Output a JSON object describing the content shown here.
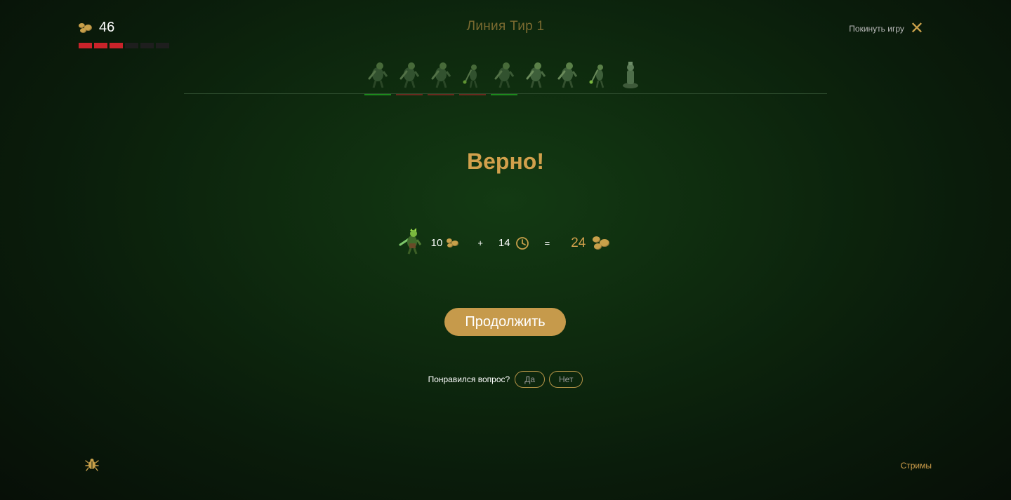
{
  "header": {
    "gold_value": "46",
    "lives_filled": 3,
    "lives_total": 6,
    "title": "Линия Тир 1",
    "leave_label": "Покинуть игру",
    "leave_icon": "close-icon"
  },
  "track": {
    "creeps": [
      {
        "type": "melee",
        "status": "correct"
      },
      {
        "type": "melee",
        "status": "wrong"
      },
      {
        "type": "melee",
        "status": "wrong"
      },
      {
        "type": "ranged",
        "status": "wrong"
      },
      {
        "type": "melee",
        "status": "correct"
      },
      {
        "type": "melee",
        "status": "pending"
      },
      {
        "type": "melee",
        "status": "pending"
      },
      {
        "type": "ranged",
        "status": "pending"
      },
      {
        "type": "tower",
        "status": "pending"
      }
    ],
    "status_colors": {
      "correct": "#1c8a1c",
      "wrong": "#6a2a1e",
      "pending": "transparent"
    }
  },
  "result": {
    "verdict": "Верно!",
    "gold_reward": "10",
    "time_bonus": "14",
    "plus": "+",
    "equals": "=",
    "total": "24"
  },
  "actions": {
    "continue_label": "Продолжить"
  },
  "feedback": {
    "question": "Понравился вопрос?",
    "yes": "Да",
    "no": "Нет"
  },
  "footer": {
    "bug_icon": "bug-icon",
    "streams_label": "Стримы"
  },
  "colors": {
    "accent": "#c69a4b",
    "verdict": "#d1a04c",
    "life_on": "#c9232a",
    "life_off": "#1e1e1e"
  }
}
